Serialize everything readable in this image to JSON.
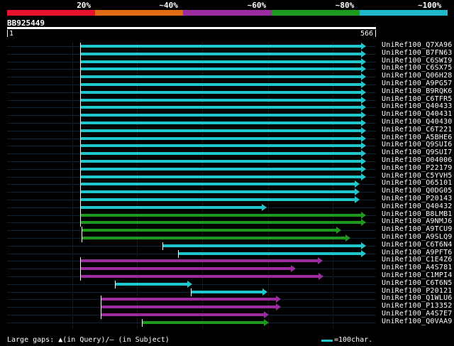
{
  "legend": {
    "colors": [
      "#e8122d",
      "#e26a13",
      "#9a2ca0",
      "#1d9a1d",
      "#1fb8c9"
    ],
    "labels": [
      "20%",
      "~40%",
      "~60%",
      "~80%",
      "~100%"
    ]
  },
  "query": {
    "id": "BB925449",
    "start": "1",
    "end": "566",
    "length": 566
  },
  "hits": [
    {
      "name": "UniRef100_Q7XA96",
      "start": 115,
      "end": 566,
      "color": "#1fc7cc"
    },
    {
      "name": "UniRef100_B7FN63",
      "start": 115,
      "end": 566,
      "color": "#1fc7cc"
    },
    {
      "name": "UniRef100_C6SWI9",
      "start": 115,
      "end": 566,
      "color": "#1fc7cc"
    },
    {
      "name": "UniRef100_C6SX75",
      "start": 115,
      "end": 566,
      "color": "#1fc7cc"
    },
    {
      "name": "UniRef100_Q06H28",
      "start": 115,
      "end": 566,
      "color": "#1fc7cc"
    },
    {
      "name": "UniRef100_A9PG57",
      "start": 115,
      "end": 566,
      "color": "#1fc7cc"
    },
    {
      "name": "UniRef100_B9RQK6",
      "start": 115,
      "end": 566,
      "color": "#1fc7cc"
    },
    {
      "name": "UniRef100_C6TFR5",
      "start": 115,
      "end": 566,
      "color": "#1fc7cc"
    },
    {
      "name": "UniRef100_Q40433",
      "start": 115,
      "end": 566,
      "color": "#1fc7cc"
    },
    {
      "name": "UniRef100_Q40431",
      "start": 115,
      "end": 566,
      "color": "#1fc7cc"
    },
    {
      "name": "UniRef100_Q40430",
      "start": 115,
      "end": 566,
      "color": "#1fc7cc"
    },
    {
      "name": "UniRef100_C6T221",
      "start": 115,
      "end": 566,
      "color": "#1fc7cc"
    },
    {
      "name": "UniRef100_A5BHE6",
      "start": 115,
      "end": 566,
      "color": "#1fc7cc"
    },
    {
      "name": "UniRef100_Q9SUI6",
      "start": 115,
      "end": 566,
      "color": "#1fc7cc"
    },
    {
      "name": "UniRef100_Q9SUI7",
      "start": 115,
      "end": 566,
      "color": "#1fc7cc"
    },
    {
      "name": "UniRef100_O04006",
      "start": 115,
      "end": 566,
      "color": "#1fc7cc"
    },
    {
      "name": "UniRef100_P22179",
      "start": 115,
      "end": 566,
      "color": "#1fc7cc"
    },
    {
      "name": "UniRef100_C5YVH5",
      "start": 115,
      "end": 566,
      "color": "#1fc7cc"
    },
    {
      "name": "UniRef100_O65101",
      "start": 115,
      "end": 556,
      "color": "#1fc7cc"
    },
    {
      "name": "UniRef100_Q0DG05",
      "start": 115,
      "end": 556,
      "color": "#1fc7cc"
    },
    {
      "name": "UniRef100_P20143",
      "start": 115,
      "end": 556,
      "color": "#1fc7cc"
    },
    {
      "name": "UniRef100_Q40432",
      "start": 115,
      "end": 409,
      "color": "#1fc7cc"
    },
    {
      "name": "UniRef100_B8LMB1",
      "start": 115,
      "end": 566,
      "color": "#1d9a1d"
    },
    {
      "name": "UniRef100_A9NMJ6",
      "start": 115,
      "end": 566,
      "color": "#1d9a1d"
    },
    {
      "name": "UniRef100_A9TCU9",
      "start": 118,
      "end": 527,
      "color": "#1d9a1d"
    },
    {
      "name": "UniRef100_A9SLQ9",
      "start": 118,
      "end": 541,
      "color": "#1d9a1d"
    },
    {
      "name": "UniRef100_C6T6N4",
      "start": 245,
      "end": 566,
      "color": "#1fc7cc"
    },
    {
      "name": "UniRef100_A9PFT6",
      "start": 270,
      "end": 566,
      "color": "#1fc7cc"
    },
    {
      "name": "UniRef100_C1E4Z6",
      "start": 115,
      "end": 498,
      "color": "#9a2ca0"
    },
    {
      "name": "UniRef100_A4S781",
      "start": 115,
      "end": 455,
      "color": "#9a2ca0"
    },
    {
      "name": "UniRef100_C1MPI4",
      "start": 115,
      "end": 499,
      "color": "#9a2ca0"
    },
    {
      "name": "UniRef100_C6T6N5",
      "start": 170,
      "end": 291,
      "color": "#1fc7cc"
    },
    {
      "name": "UniRef100_P20121",
      "start": 290,
      "end": 410,
      "color": "#1fc7cc"
    },
    {
      "name": "UniRef100_Q1WLU6",
      "start": 148,
      "end": 432,
      "color": "#9a2ca0"
    },
    {
      "name": "UniRef100_P13352",
      "start": 148,
      "end": 432,
      "color": "#9a2ca0"
    },
    {
      "name": "UniRef100_A4S7E7",
      "start": 148,
      "end": 412,
      "color": "#9a2ca0"
    },
    {
      "name": "UniRef100_Q0VAA9",
      "start": 213,
      "end": 412,
      "color": "#1d9a1d"
    }
  ],
  "footer": {
    "gaps_text": "Large gaps: ▲(in Query)/– (in Subject)",
    "scale_text": "=100char."
  }
}
